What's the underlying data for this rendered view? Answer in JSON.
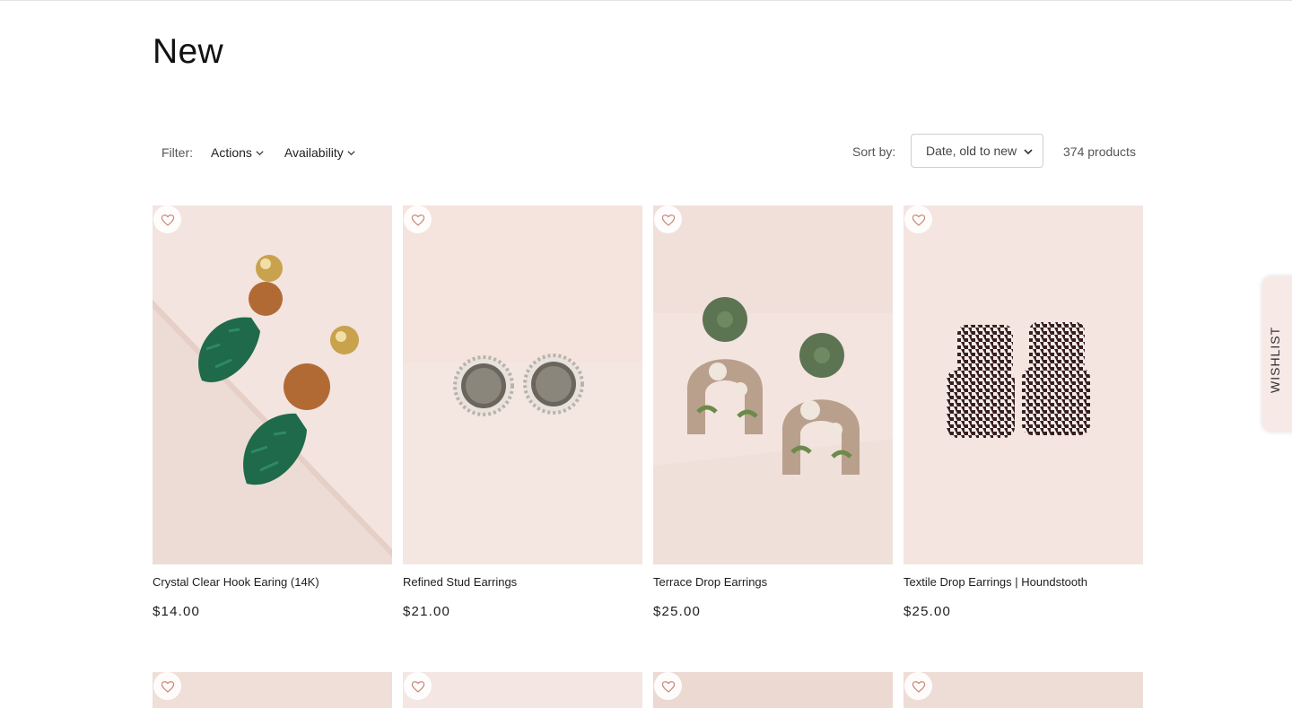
{
  "page": {
    "title": "New"
  },
  "filters": {
    "label": "Filter:",
    "items": [
      {
        "label": "Actions"
      },
      {
        "label": "Availability"
      }
    ]
  },
  "sort": {
    "label": "Sort by:",
    "selected": "Date, old to new"
  },
  "product_count": "374 products",
  "products": [
    {
      "title": "Crystal Clear Hook Earing (14K)",
      "price": "$14.00"
    },
    {
      "title": "Refined Stud Earrings",
      "price": "$21.00"
    },
    {
      "title": "Terrace Drop Earrings",
      "price": "$25.00"
    },
    {
      "title": "Textile Drop Earrings | Houndstooth",
      "price": "$25.00"
    }
  ],
  "wishlist_tab": {
    "label": "WISHLIST"
  },
  "colors": {
    "background_pink": "#f3e4e0",
    "accent_tab": "#f7e9e6"
  }
}
